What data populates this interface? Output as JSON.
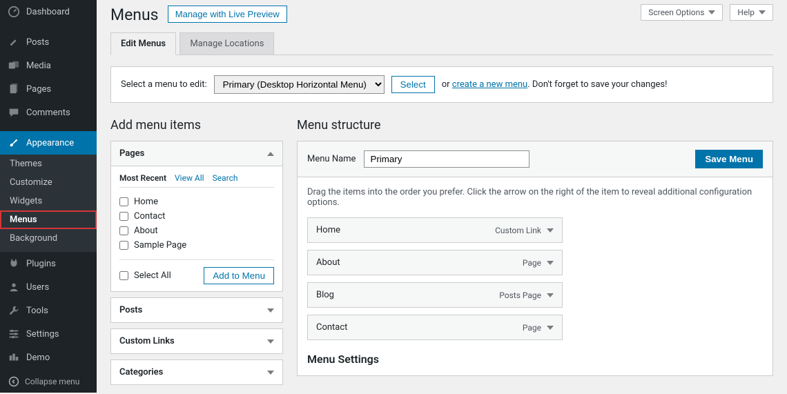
{
  "sidebar": {
    "items": [
      {
        "label": "Dashboard"
      },
      {
        "label": "Posts"
      },
      {
        "label": "Media"
      },
      {
        "label": "Pages"
      },
      {
        "label": "Comments"
      },
      {
        "label": "Appearance"
      },
      {
        "label": "Plugins"
      },
      {
        "label": "Users"
      },
      {
        "label": "Tools"
      },
      {
        "label": "Settings"
      },
      {
        "label": "Demo"
      }
    ],
    "subs": [
      "Themes",
      "Customize",
      "Widgets",
      "Menus",
      "Background"
    ],
    "collapse": "Collapse menu"
  },
  "top": {
    "screen_options": "Screen Options",
    "help": "Help"
  },
  "page": {
    "title": "Menus",
    "preview_btn": "Manage with Live Preview"
  },
  "tabs": [
    "Edit Menus",
    "Manage Locations"
  ],
  "selectbar": {
    "label": "Select a menu to edit:",
    "selected": "Primary (Desktop Horizontal Menu)",
    "select_btn": "Select",
    "or": "or",
    "create_link": "create a new menu",
    "tail": ". Don't forget to save your changes!"
  },
  "left": {
    "heading": "Add menu items",
    "pages_head": "Pages",
    "mini_tabs": [
      "Most Recent",
      "View All",
      "Search"
    ],
    "page_items": [
      "Home",
      "Contact",
      "About",
      "Sample Page"
    ],
    "select_all": "Select All",
    "add_btn": "Add to Menu",
    "closed": [
      "Posts",
      "Custom Links",
      "Categories"
    ]
  },
  "right": {
    "heading": "Menu structure",
    "name_label": "Menu Name",
    "name_value": "Primary",
    "save_btn": "Save Menu",
    "hint": "Drag the items into the order you prefer. Click the arrow on the right of the item to reveal additional configuration options.",
    "items": [
      {
        "label": "Home",
        "type": "Custom Link"
      },
      {
        "label": "About",
        "type": "Page"
      },
      {
        "label": "Blog",
        "type": "Posts Page"
      },
      {
        "label": "Contact",
        "type": "Page"
      }
    ],
    "settings_head": "Menu Settings"
  }
}
